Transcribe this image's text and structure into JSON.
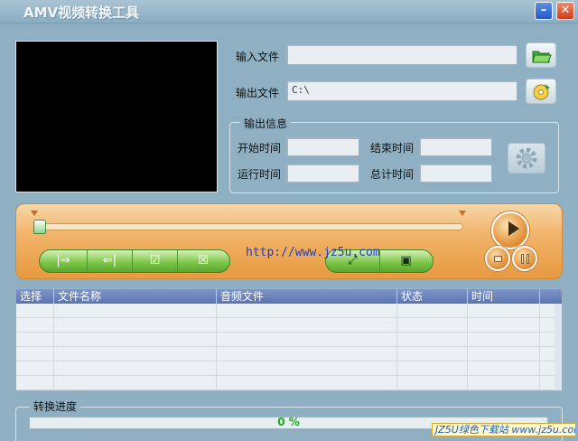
{
  "window": {
    "title": "AMV视频转换工具",
    "minimize": "–",
    "close": "✕"
  },
  "input": {
    "label": "输入文件",
    "value": ""
  },
  "output": {
    "label": "输出文件",
    "value": "C:\\"
  },
  "info": {
    "title": "输出信息",
    "start_label": "开始时间",
    "start_value": "",
    "end_label": "结束时间",
    "end_value": "",
    "run_label": "运行时间",
    "run_value": "",
    "total_label": "总计时间",
    "total_value": ""
  },
  "player": {
    "url": "http://www.jz5u.com",
    "left_buttons": [
      "|⇒",
      "⇐|",
      "☑",
      "☒"
    ],
    "right_buttons": [
      "⤢",
      "▣"
    ],
    "slider_position": 0
  },
  "table": {
    "columns": [
      "选择",
      "文件名称",
      "音频文件",
      "状态",
      "时间"
    ]
  },
  "progress": {
    "title": "转换进度",
    "value_text": "0 %",
    "value": 0
  },
  "watermark": "JZ5U绿色下载站 www.jz5u.com",
  "colors": {
    "accent_orange": "#e79a3f",
    "button_green": "#7fc64a",
    "header_blue": "#5a74b1"
  }
}
